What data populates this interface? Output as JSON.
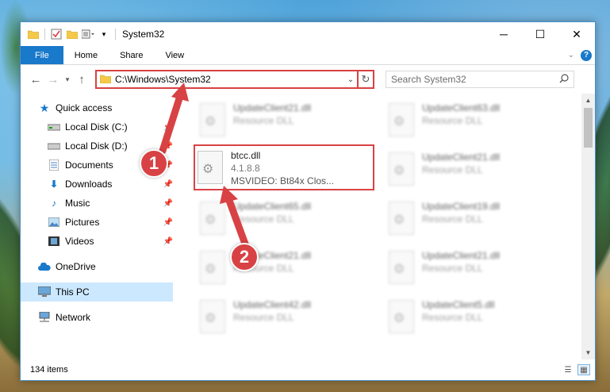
{
  "window": {
    "title": "System32"
  },
  "ribbon": {
    "tabs": [
      "File",
      "Home",
      "Share",
      "View"
    ]
  },
  "address": {
    "path": "C:\\Windows\\System32"
  },
  "search": {
    "placeholder": "Search System32"
  },
  "sidebar": {
    "quick_access": "Quick access",
    "items": [
      {
        "label": "Local Disk (C:)",
        "icon": "drive-icon"
      },
      {
        "label": "Local Disk (D:)",
        "icon": "drive-icon"
      },
      {
        "label": "Documents",
        "icon": "documents-icon"
      },
      {
        "label": "Downloads",
        "icon": "downloads-icon"
      },
      {
        "label": "Music",
        "icon": "music-icon"
      },
      {
        "label": "Pictures",
        "icon": "pictures-icon"
      },
      {
        "label": "Videos",
        "icon": "videos-icon"
      }
    ],
    "onedrive": "OneDrive",
    "this_pc": "This PC",
    "network": "Network"
  },
  "files": [
    {
      "name": "UpdateClient21.dll",
      "desc": "Resource DLL"
    },
    {
      "name": "UpdateClient63.dll",
      "desc": "Resource DLL"
    },
    {
      "name": "UpdateClient21.dll",
      "desc": "Resource DLL"
    },
    {
      "name": "UpdateClient65.dll",
      "desc": "Resource DLL"
    },
    {
      "name": "UpdateClient19.dll",
      "desc": "Resource DLL"
    },
    {
      "name": "UpdateClient21.dll",
      "desc": "Resource DLL"
    },
    {
      "name": "UpdateClient21.dll",
      "desc": "Resource DLL"
    },
    {
      "name": "UpdateClient42.dll",
      "desc": "Resource DLL"
    },
    {
      "name": "UpdateClient5.dll",
      "desc": "Resource DLL"
    }
  ],
  "highlighted_file": {
    "name": "btcc.dll",
    "version": "4.1.8.8",
    "desc": "MSVIDEO: Bt84x Clos..."
  },
  "callouts": [
    "1",
    "2"
  ],
  "status": {
    "items": "134 items"
  },
  "colors": {
    "accent": "#1979ca",
    "highlight": "#d84244",
    "selected": "#cce8ff"
  }
}
